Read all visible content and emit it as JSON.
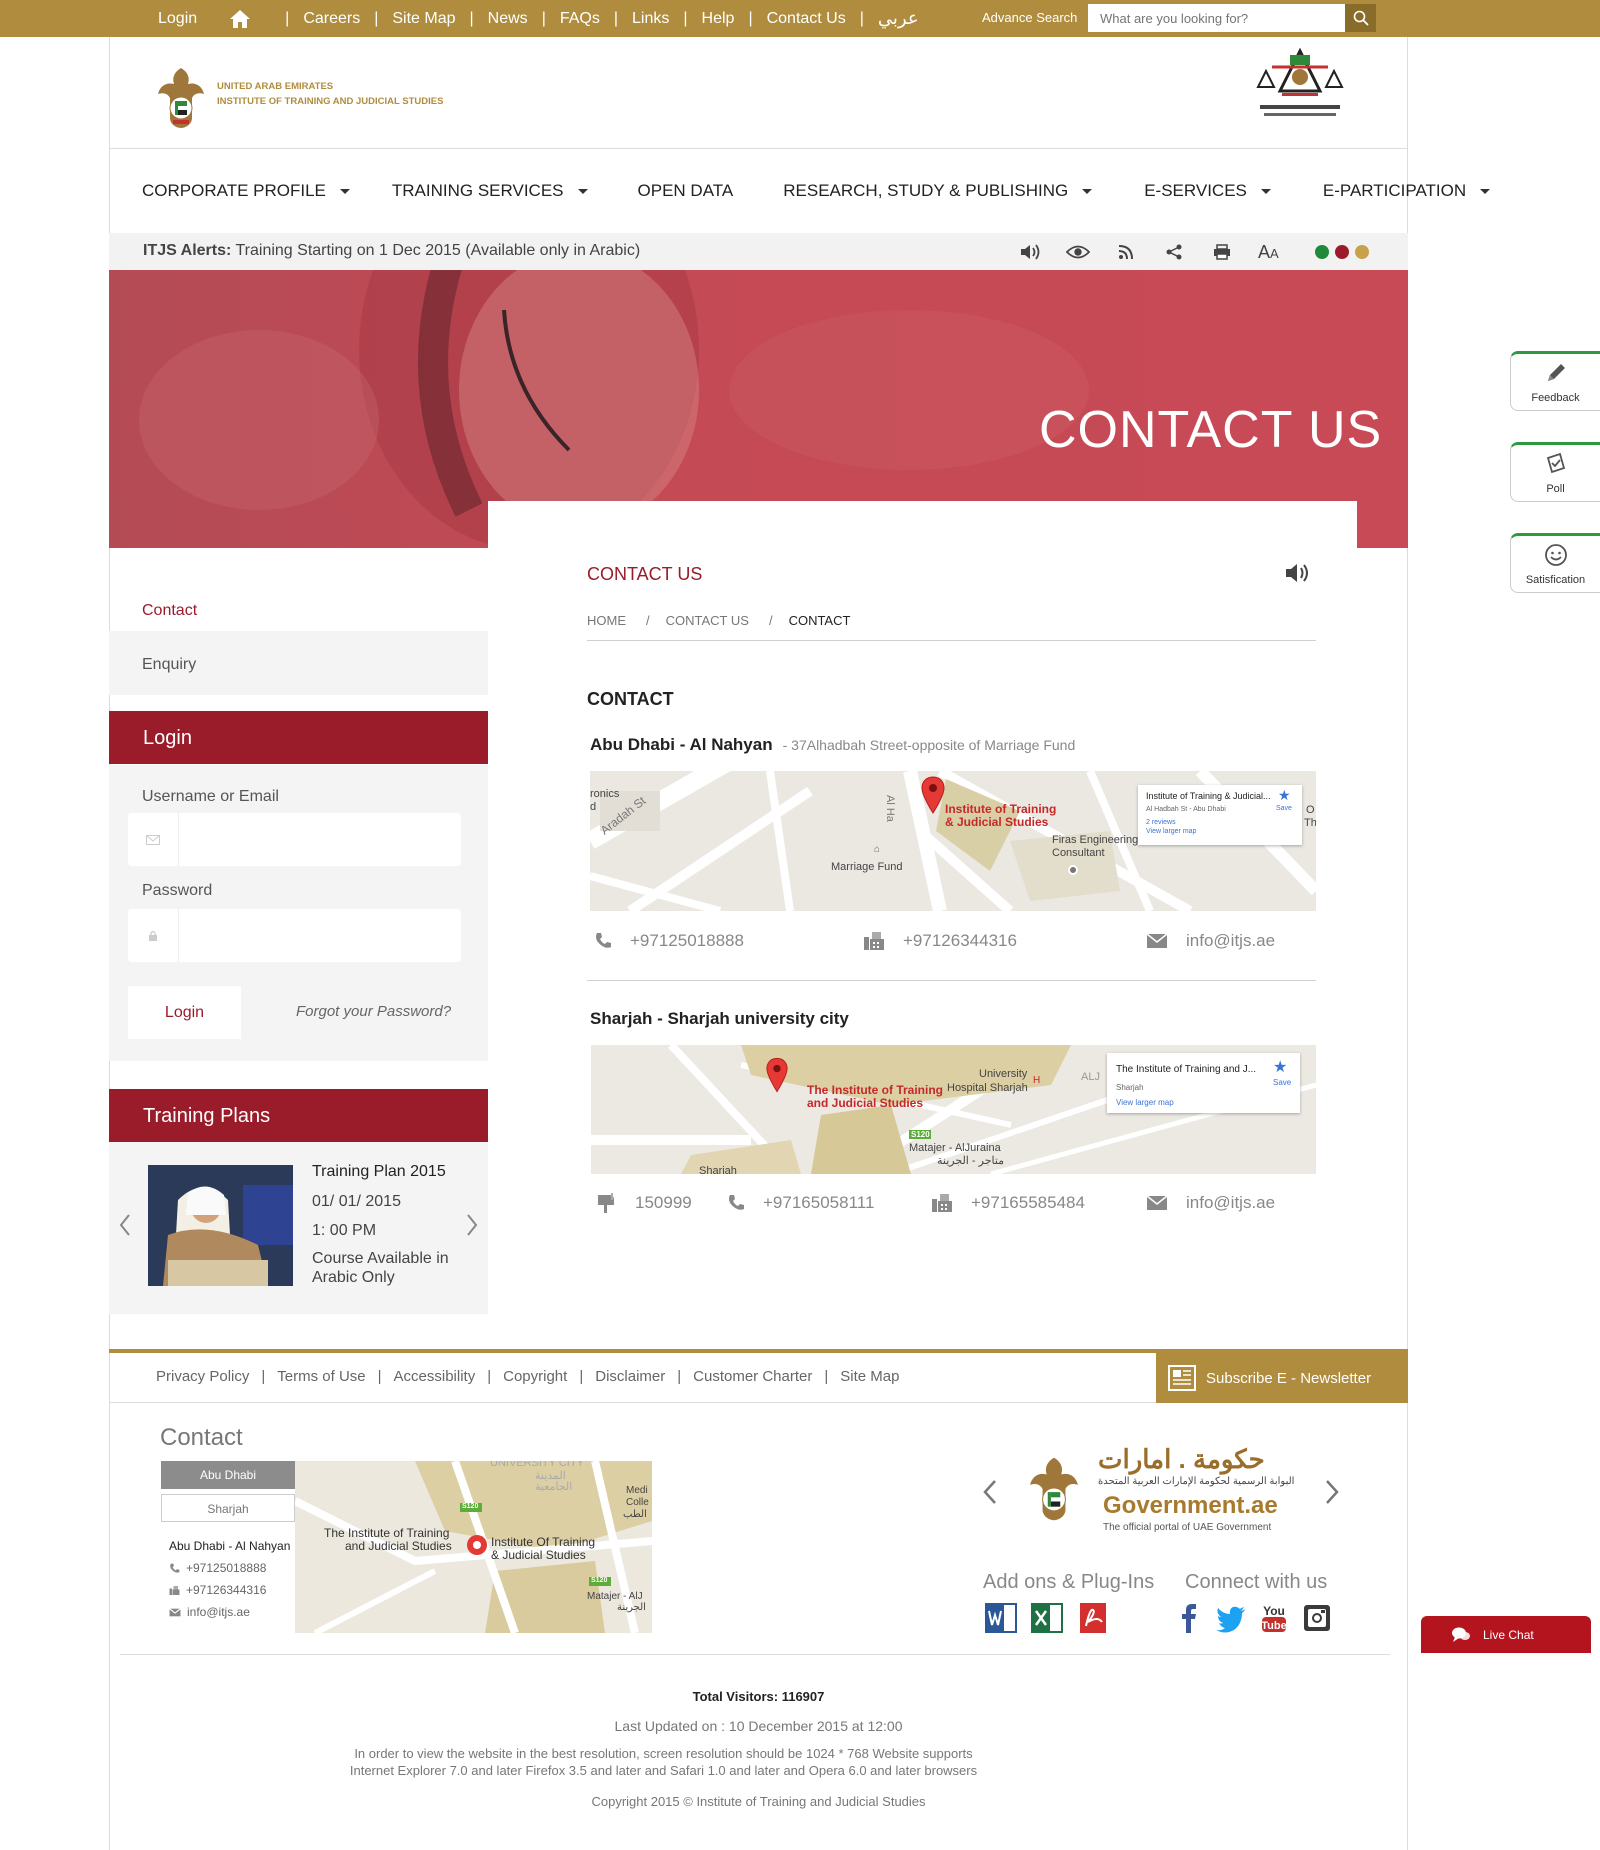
{
  "topbar": {
    "links": [
      "Login",
      "Careers",
      "Site Map",
      "News",
      "FAQs",
      "Links",
      "Help",
      "Contact Us"
    ],
    "arabic": "عربي",
    "advance_search": "Advance Search",
    "search_placeholder": "What are you looking for?",
    "accent": "#b08d3e"
  },
  "header": {
    "org_line1": "UNITED ARAB EMIRATES",
    "org_line2": "INSTITUTE OF TRAINING AND JUDICIAL STUDIES"
  },
  "nav": [
    {
      "label": "CORPORATE PROFILE",
      "has_menu": true
    },
    {
      "label": "TRAINING SERVICES",
      "has_menu": true
    },
    {
      "label": "OPEN DATA",
      "has_menu": false
    },
    {
      "label": "RESEARCH, STUDY & PUBLISHING",
      "has_menu": true
    },
    {
      "label": "E-SERVICES",
      "has_menu": true
    },
    {
      "label": "E-PARTICIPATION",
      "has_menu": true
    }
  ],
  "alerts": {
    "label": "ITJS Alerts:",
    "text": "Training Starting on 1 Dec 2015 (Available only in Arabic)",
    "font_big": "A",
    "font_small": "A",
    "theme_colors": [
      "#1e8a3a",
      "#9a1c2a",
      "#c9a14a"
    ]
  },
  "hero": {
    "title": "CONTACT US"
  },
  "sidebar": {
    "items": [
      "Contact",
      "Enquiry"
    ],
    "login": {
      "title": "Login",
      "username_label": "Username or Email",
      "password_label": "Password",
      "button": "Login",
      "forgot": "Forgot your Password?"
    },
    "training": {
      "title": "Training Plans",
      "plan_title": "Training Plan 2015",
      "date": "01/ 01/ 2015",
      "time": "1: 00 PM",
      "note": "Course Available in Arabic Only"
    }
  },
  "main": {
    "title": "CONTACT US",
    "breadcrumb": [
      "HOME",
      "CONTACT US",
      "CONTACT"
    ],
    "section_title": "CONTACT",
    "locations": [
      {
        "name": "Abu Dhabi - Al Nahyan",
        "address": "- 37Alhadbah Street-opposite of Marriage Fund",
        "phone": "+97125018888",
        "fax": "+97126344316",
        "email": "info@itjs.ae",
        "map": {
          "labels": [
            "ronics",
            "d",
            "Aradah St",
            "Al Ha",
            "Marriage Fund",
            "Firas Engineering",
            "Consultant",
            "O",
            "The"
          ],
          "pin_label_1": "Institute of Training",
          "pin_label_2": "& Judicial Studies",
          "card_title": "Institute of Training & Judicial...",
          "card_addr": "Al Hadbah St - Abu Dhabi",
          "card_reviews": "2 reviews",
          "card_link": "View larger map",
          "card_save": "Save"
        }
      },
      {
        "name": "Sharjah - Sharjah university city",
        "pobox": "150999",
        "phone": "+97165058111",
        "fax": "+97165585484",
        "email": "info@itjs.ae",
        "map": {
          "labels": [
            "University",
            "Hospital Sharjah",
            "H",
            "ALJ",
            "S120",
            "Matajer - AlJuraina",
            "متاجر - الجرينة",
            "Sharjah"
          ],
          "pin_label_1": "The Institute of Training",
          "pin_label_2": "and Judicial Studies",
          "card_title": "The Institute of Training and J...",
          "card_addr": "Sharjah",
          "card_link": "View larger map",
          "card_save": "Save"
        }
      }
    ]
  },
  "widgets": [
    {
      "label": "Feedback",
      "icon": "pencil-icon"
    },
    {
      "label": "Poll",
      "icon": "poll-icon"
    },
    {
      "label": "Satisfication",
      "icon": "smiley-icon"
    }
  ],
  "livechat": "Live Chat",
  "footer": {
    "links": [
      "Privacy Policy",
      "Terms of Use",
      "Accessibility",
      "Copyright",
      "Disclaimer",
      "Customer Charter",
      "Site Map"
    ],
    "subscribe": "Subscribe E - Newsletter",
    "contact_title": "Contact",
    "tabs": [
      "Abu Dhabi",
      "Sharjah"
    ],
    "contact_name": "Abu Dhabi - Al Nahyan",
    "contact_phone": "+97125018888",
    "contact_fax": "+97126344316",
    "contact_email": "info@itjs.ae",
    "map": {
      "labels": [
        "UNIVERSITY CITY",
        "المدينة",
        "الجامعية",
        "Medi",
        "Colle",
        "الطب",
        "S120",
        "S120",
        "Matajer - AlJ",
        "الجرينة"
      ],
      "pin_label_1": "Institute Of Training",
      "pin_label_2": "& Judicial Studies",
      "side_label_1": "The Institute of Training",
      "side_label_2": "and Judicial Studies"
    },
    "gov": {
      "arabic": "حكومة . امارات",
      "arabic_sub": "البوابة الرسمية لحكومة الإمارات العربية المتحدة",
      "english": "Government.ae",
      "tagline": "The official portal of UAE Government"
    },
    "addons_title": "Add ons & Plug-Ins",
    "connect_title": "Connect with us",
    "total_visitors": "Total Visitors: 116907",
    "last_updated": "Last Updated on : 10 December 2015 at 12:00",
    "resolution_note": "In order to view the website in the best resolution, screen resolution should be 1024 * 768 Website supports Internet Explorer 7.0 and later Firefox 3.5 and later and Safari 1.0 and later and Opera 6.0 and later browsers",
    "copyright": "Copyright 2015 © Institute of Training and Judicial Studies"
  }
}
